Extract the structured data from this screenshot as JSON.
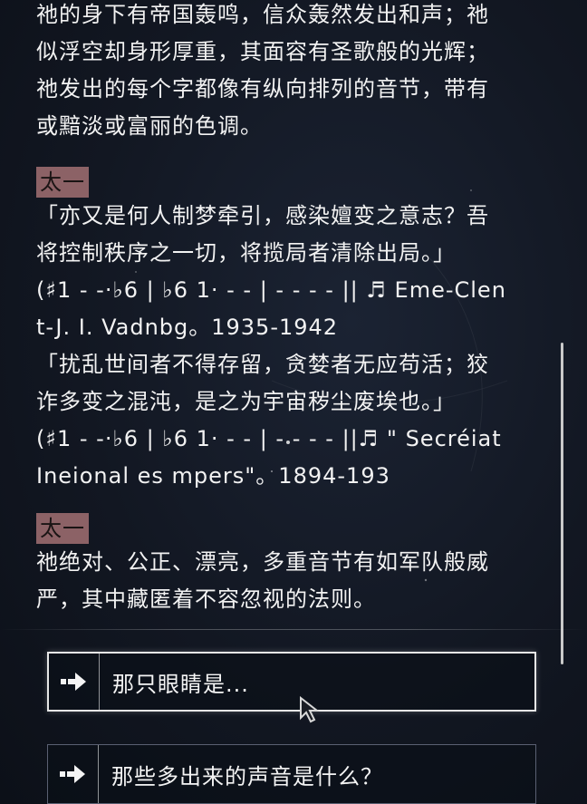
{
  "dialog": {
    "intro_text": "祂的身下有帝国轰鸣，信众轰然发出和声；祂\n似浮空却身形厚重，其面容有圣歌般的光辉；\n祂发出的每个字都像有纵向排列的音节，带有\n或黯淡或富丽的色调。",
    "speaker1": "太一",
    "speech1": "「亦又是何人制梦牵引，感染嬗变之意志？吾\n将控制秩序之一切，将揽局者清除出局。」\n(♯1 - -·♭6 | ♭6 1· - - | - - - - || ♬ Eme-Clen\nt-J. I. Vadnbg。1935-1942\n「扰乱世间者不得存留，贪婪者无应苟活；狡\n诈多变之混沌，是之为宇宙秽尘废埃也。」\n(♯1 - -·♭6 | ♭6 1· - - | - - - - ||♬ \" Secréiat\nIneional es mpers\"。1894-193",
    "speaker2": "太一",
    "speech2": "祂绝对、公正、漂亮，多重音节有如军队般威\n严，其中藏匿着不容忽视的法则。"
  },
  "options": [
    {
      "label": "那只眼睛是...",
      "icon": "arrow-right-icon"
    },
    {
      "label": "那些多出来的声音是什么？",
      "icon": "arrow-right-icon"
    }
  ],
  "colors": {
    "background": "#121722",
    "speaker_tag": "#8c6266",
    "text": "#f2f2f2",
    "selected_border": "#e6e6e6"
  }
}
